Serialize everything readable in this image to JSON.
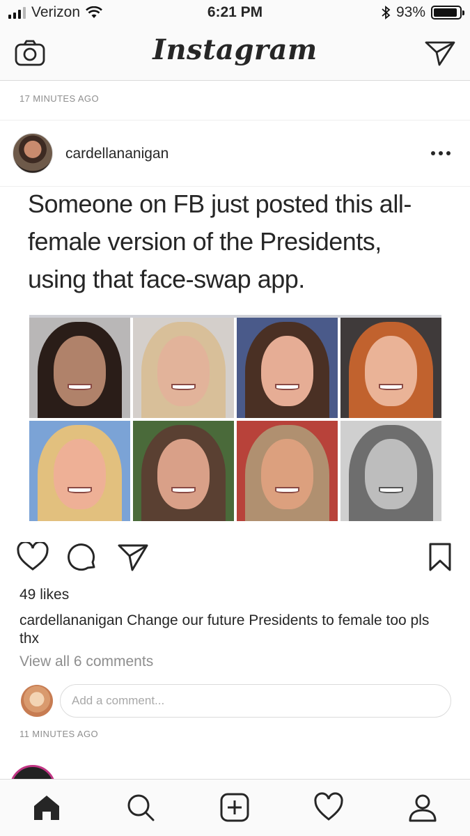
{
  "status_bar": {
    "carrier": "Verizon",
    "time": "6:21 PM",
    "battery_percent": "93%",
    "battery_level": 0.93,
    "icons": [
      "signal-icon",
      "wifi-icon",
      "bluetooth-icon",
      "battery-icon"
    ]
  },
  "header": {
    "logo": "Instagram",
    "icons": [
      "camera-icon",
      "direct-send-icon"
    ]
  },
  "previous_post": {
    "time_ago": "17 MINUTES AGO"
  },
  "post": {
    "username": "cardellananigan",
    "image_text": "Someone on FB just posted this all-female version of the Presidents, using that face-swap app.",
    "likes": "49 likes",
    "caption_user": "cardellananigan",
    "caption_text": "Change our future Presidents to female too pls thx",
    "view_comments": "View all 6 comments",
    "comment_placeholder": "Add a comment...",
    "time_ago": "11 MINUTES AGO"
  },
  "tabbar": {
    "icons": [
      "home-icon",
      "search-icon",
      "add-icon",
      "activity-heart-icon",
      "profile-icon"
    ]
  },
  "colors": {
    "text": "#262626",
    "muted": "#8e8e8e",
    "border": "#dbdbdb",
    "bar_bg": "#fafafa"
  }
}
